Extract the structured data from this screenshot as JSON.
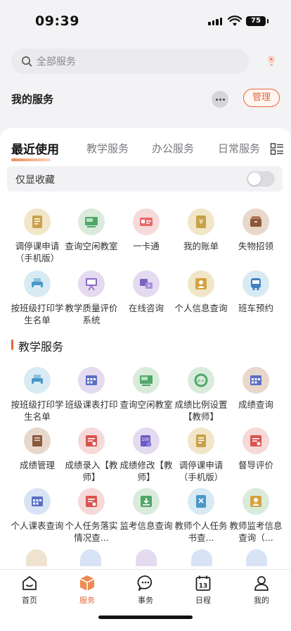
{
  "status_bar": {
    "time": "09:39",
    "battery": "75"
  },
  "header": {
    "search_placeholder": "全部服务",
    "my_services": "我的服务",
    "manage": "管理"
  },
  "tabs": [
    "最近使用",
    "教学服务",
    "办公服务",
    "日常服务"
  ],
  "favorites_only": {
    "label": "仅显收藏",
    "on": false
  },
  "recent": [
    {
      "label": "调停课申请（手机版）",
      "icon": "form-icon",
      "color": "#f2e6c8"
    },
    {
      "label": "查询空闲教室",
      "icon": "classroom-board-icon",
      "color": "#d9ecdc"
    },
    {
      "label": "一卡通",
      "icon": "card-icon",
      "color": "#f6d9d9"
    },
    {
      "label": "我的账单",
      "icon": "bill-icon",
      "color": "#f2e6c8"
    },
    {
      "label": "失物招领",
      "icon": "box-icon",
      "color": "#e8d8cc"
    },
    {
      "label": "按班级打印学生名单",
      "icon": "printer-icon",
      "color": "#d8eaf3"
    },
    {
      "label": "教学质量评价系统",
      "icon": "presentation-icon",
      "color": "#e4dbf0"
    },
    {
      "label": "在线咨询",
      "icon": "consult-icon",
      "color": "#e4dbf0"
    },
    {
      "label": "个人信息查询",
      "icon": "id-card-icon",
      "color": "#f2e6c8"
    },
    {
      "label": "班车预约",
      "icon": "bus-icon",
      "color": "#d8eaf3"
    }
  ],
  "teaching_section": {
    "title": "教学服务",
    "items": [
      {
        "label": "按班级打印学生名单",
        "icon": "printer-icon",
        "color": "#d8eaf3"
      },
      {
        "label": "班级课表打印",
        "icon": "timetable-icon",
        "color": "#e4dbf0"
      },
      {
        "label": "查询空闲教室",
        "icon": "classroom-board-icon",
        "color": "#d9ecdc"
      },
      {
        "label": "成绩比例设置【教师】",
        "icon": "grade-ratio-icon",
        "color": "#d9ecdc"
      },
      {
        "label": "成绩查询",
        "icon": "calendar-grid-icon",
        "color": "#e8d8cc"
      },
      {
        "label": "成绩管理",
        "icon": "notebook-icon",
        "color": "#e8d8cc"
      },
      {
        "label": "成绩录入【教师】",
        "icon": "grade-entry-icon",
        "color": "#f6d9d9"
      },
      {
        "label": "成绩修改【教师】",
        "icon": "grade-edit-icon",
        "color": "#e4dbf0"
      },
      {
        "label": "调停课申请（手机版）",
        "icon": "form-icon",
        "color": "#f2e6c8"
      },
      {
        "label": "督导评价",
        "icon": "supervision-icon",
        "color": "#f6d9d9"
      },
      {
        "label": "个人课表查询",
        "icon": "table-icon",
        "color": "#d8e4f5"
      },
      {
        "label": "个人任务落实情况查...",
        "icon": "task-icon",
        "color": "#f6d9d9"
      },
      {
        "label": "监考信息查询",
        "icon": "exam-download-icon",
        "color": "#d9ecdc"
      },
      {
        "label": "教师个人任务书查...",
        "icon": "document-x-icon",
        "color": "#d8eaf3"
      },
      {
        "label": "教师监考信息查询（...",
        "icon": "exam-person-icon",
        "color": "#d9ecdc"
      }
    ]
  },
  "bottom_nav": [
    {
      "label": "首页",
      "icon": "home-icon",
      "active": false
    },
    {
      "label": "服务",
      "icon": "service-cube-icon",
      "active": true
    },
    {
      "label": "事务",
      "icon": "chat-bubble-icon",
      "active": false
    },
    {
      "label": "日程",
      "icon": "calendar-icon",
      "active": false
    },
    {
      "label": "我的",
      "icon": "person-icon",
      "active": false
    }
  ],
  "colors": {
    "accent": "#e4683a"
  }
}
